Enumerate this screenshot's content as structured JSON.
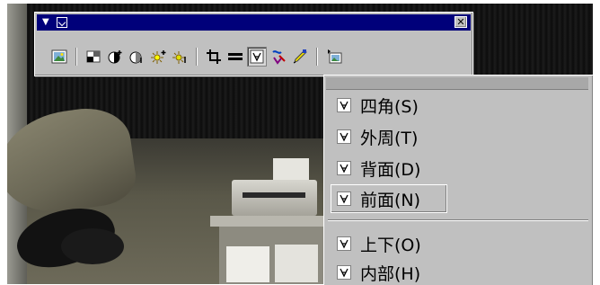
{
  "toolbar": {
    "title_arrow": "▼",
    "close_label": "✕",
    "tools": [
      {
        "name": "insert-picture-icon"
      },
      {
        "name": "image-control-icon"
      },
      {
        "name": "more-contrast-icon"
      },
      {
        "name": "less-contrast-icon"
      },
      {
        "name": "more-brightness-icon"
      },
      {
        "name": "less-brightness-icon"
      },
      {
        "name": "crop-icon"
      },
      {
        "name": "line-style-icon"
      },
      {
        "name": "text-wrapping-icon"
      },
      {
        "name": "format-picture-icon"
      },
      {
        "name": "set-transparent-color-icon"
      },
      {
        "name": "reset-picture-icon"
      }
    ]
  },
  "wrap_menu": {
    "items": [
      {
        "label": "四角(S)"
      },
      {
        "label": "外周(T)"
      },
      {
        "label": "背面(D)"
      },
      {
        "label": "前面(N)"
      },
      {
        "label": "上下(O)"
      },
      {
        "label": "内部(H)"
      }
    ]
  },
  "colors": {
    "titlebar": "#00007a",
    "face": "#c0c0c0"
  }
}
